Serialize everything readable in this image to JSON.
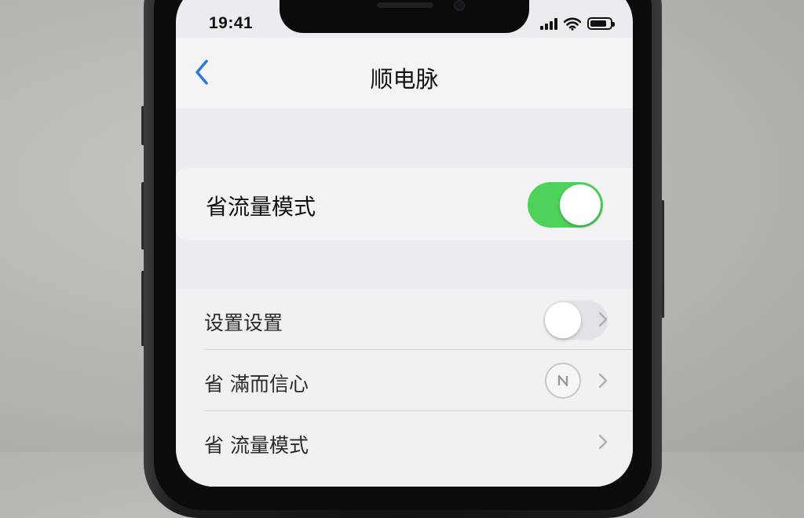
{
  "status_bar": {
    "time": "19:41",
    "icons": [
      "cellular-signal-icon",
      "wifi-icon",
      "battery-icon"
    ]
  },
  "nav": {
    "back_icon": "chevron-left-icon",
    "title": "顺电脉"
  },
  "primary_setting": {
    "label": "省流量模式",
    "toggle_state": "on",
    "toggle_color": "#4fd25b"
  },
  "settings_list": [
    {
      "label": "设置设置",
      "control": "toggle-off",
      "chevron": "chevron-right-icon"
    },
    {
      "label": "省 滿而信心",
      "control": "circle-icon",
      "chevron": "chevron-right-icon"
    },
    {
      "label": "省 流量模式",
      "control": "none",
      "chevron": "chevron-right-icon"
    }
  ],
  "colors": {
    "accent_blue": "#2f7bd9",
    "toggle_on": "#4fd25b",
    "background": "#ecebf0"
  }
}
